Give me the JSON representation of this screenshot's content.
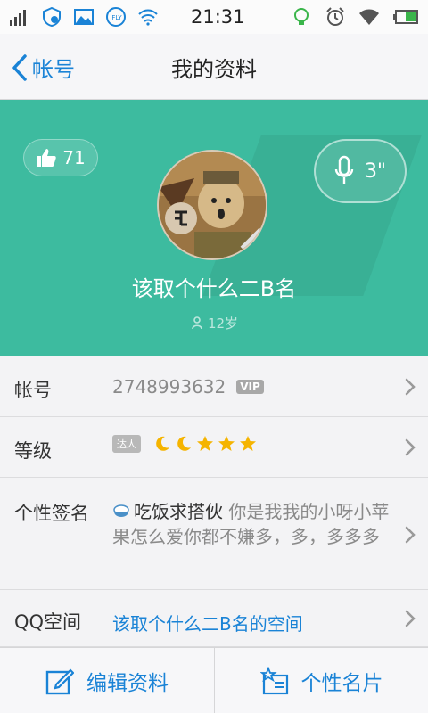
{
  "status_bar": {
    "time": "21:31",
    "left_icons": [
      "signal-icon",
      "shield-icon",
      "image-icon",
      "ifly-icon",
      "wifi-icon"
    ],
    "right_icons": [
      "bulb-icon",
      "alarm-icon",
      "wifi-icon",
      "battery-icon"
    ],
    "ifly_text": "iFLY"
  },
  "nav": {
    "back_label": "帐号",
    "title": "我的资料"
  },
  "profile": {
    "likes": "71",
    "voice_duration": "3\"",
    "nickname": "该取个什么二B名",
    "age": "12岁",
    "gender_icon": "male-icon",
    "header_color": "#3dbb9f"
  },
  "rows": {
    "account": {
      "label": "帐号",
      "value": "2748993632",
      "badge": "VIP"
    },
    "level": {
      "label": "等级",
      "badge": "达人",
      "moons": 2,
      "stars": 3
    },
    "signature": {
      "label": "个性签名",
      "action": "吃饭求搭伙",
      "text": "你是我我的小呀小苹果怎么爱你都不嫌多，多，多多多"
    },
    "qzone": {
      "label": "QQ空间",
      "value": "该取个什么二B名的空间"
    }
  },
  "bottom": {
    "edit_label": "编辑资料",
    "card_label": "个性名片"
  },
  "colors": {
    "accent": "#1a83d6",
    "teal": "#3dbb9f"
  }
}
